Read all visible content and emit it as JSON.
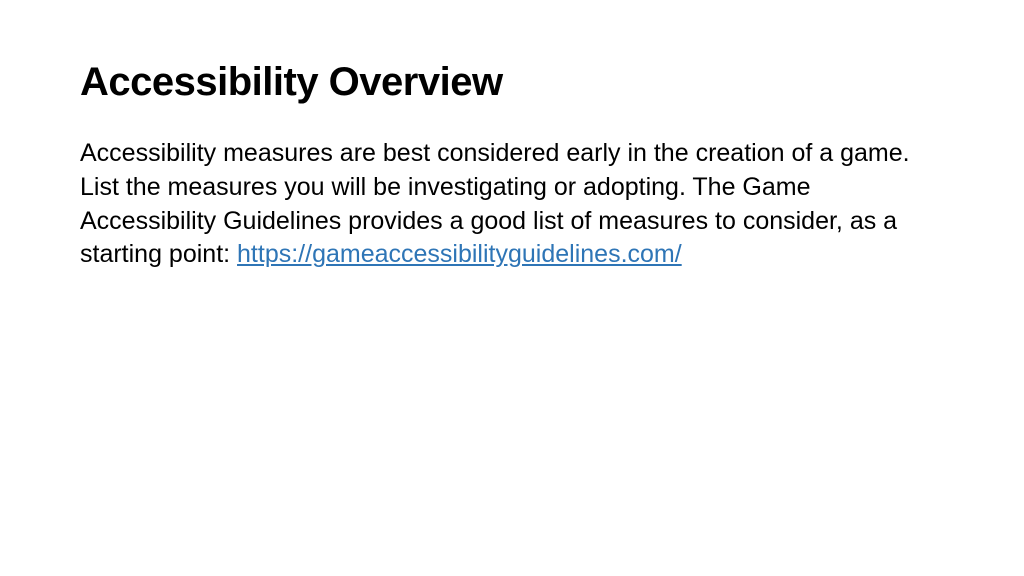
{
  "title": "Accessibility Overview",
  "body": "Accessibility measures are best considered early in the creation of a game. List the measures you will be investigating or adopting. The Game Accessibility Guidelines provides a good list of measures to consider, as a starting point: ",
  "link": "https://gameaccessibilityguidelines.com/"
}
